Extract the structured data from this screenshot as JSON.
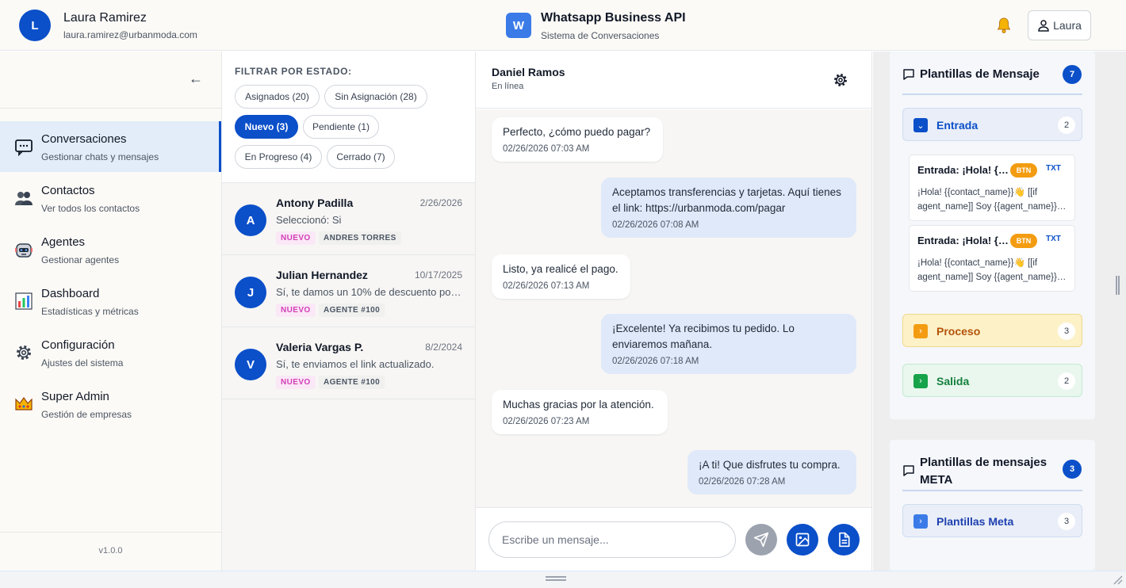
{
  "header": {
    "user_initial": "L",
    "user_name": "Laura Ramirez",
    "user_email": "laura.ramirez@urbanmoda.com",
    "app_initial": "W",
    "app_title": "Whatsapp Business API",
    "app_subtitle": "Sistema de Conversaciones",
    "user_button": "Laura",
    "icons": [
      "bell-icon",
      "user-icon"
    ]
  },
  "sidebar": {
    "collapse_icon": "←",
    "items": [
      {
        "title": "Conversaciones",
        "subtitle": "Gestionar chats y mensajes",
        "icon": "chat-icon",
        "active": true
      },
      {
        "title": "Contactos",
        "subtitle": "Ver todos los contactos",
        "icon": "contacts-icon",
        "active": false
      },
      {
        "title": "Agentes",
        "subtitle": "Gestionar agentes",
        "icon": "robot-icon",
        "active": false
      },
      {
        "title": "Dashboard",
        "subtitle": "Estadísticas y métricas",
        "icon": "bar-chart-icon",
        "active": false
      },
      {
        "title": "Configuración",
        "subtitle": "Ajustes del sistema",
        "icon": "gear-icon",
        "active": false
      },
      {
        "title": "Super Admin",
        "subtitle": "Gestión de empresas",
        "icon": "crown-icon",
        "active": false
      }
    ],
    "version": "v1.0.0"
  },
  "filters": {
    "label": "FILTRAR POR ESTADO:",
    "chips": [
      {
        "label": "Asignados (20)",
        "active": false
      },
      {
        "label": "Sin Asignación (28)",
        "active": false
      },
      {
        "label": "Nuevo (3)",
        "active": true
      },
      {
        "label": "Pendiente (1)",
        "active": false
      },
      {
        "label": "En Progreso (4)",
        "active": false
      },
      {
        "label": "Cerrado (7)",
        "active": false
      }
    ]
  },
  "conversations": [
    {
      "initial": "A",
      "name": "Antony Padilla",
      "date": "2/26/2026",
      "preview": "Seleccionó: Si",
      "status_tag": "NUEVO",
      "agent_tag": "ANDRES TORRES"
    },
    {
      "initial": "J",
      "name": "Julian Hernandez",
      "date": "10/17/2025",
      "preview": "Sí, te damos un 10% de descuento por …",
      "status_tag": "NUEVO",
      "agent_tag": "AGENTE #100"
    },
    {
      "initial": "V",
      "name": "Valeria Vargas P.",
      "date": "8/2/2024",
      "preview": "Sí, te enviamos el link actualizado.",
      "status_tag": "NUEVO",
      "agent_tag": "AGENTE #100"
    }
  ],
  "chat": {
    "contact_name": "Daniel Ramos",
    "contact_status": "En línea",
    "messages": [
      {
        "direction": "in",
        "text": "Perfecto, ¿cómo puedo pagar?",
        "time": "02/26/2026 07:03 AM"
      },
      {
        "direction": "out",
        "text": "Aceptamos transferencias y tarjetas. Aquí tienes el link: https://urbanmoda.com/pagar",
        "time": "02/26/2026 07:08 AM"
      },
      {
        "direction": "in",
        "text": "Listo, ya realicé el pago.",
        "time": "02/26/2026 07:13 AM"
      },
      {
        "direction": "out",
        "text": "¡Excelente! Ya recibimos tu pedido. Lo enviaremos mañana.",
        "time": "02/26/2026 07:18 AM"
      },
      {
        "direction": "in",
        "text": "Muchas gracias por la atención.",
        "time": "02/26/2026 07:23 AM"
      },
      {
        "direction": "out",
        "text": "¡A ti! Que disfrutes tu compra.",
        "time": "02/26/2026 07:28 AM"
      }
    ],
    "input_placeholder": "Escribe un mensaje...",
    "action_icons": [
      "send-icon",
      "image-icon",
      "document-icon"
    ]
  },
  "templates": {
    "title": "Plantillas de Mensaje",
    "count": "7",
    "sections": [
      {
        "label": "Entrada",
        "count": "2",
        "expanded": true,
        "color": "#0b4fc9"
      },
      {
        "label": "Proceso",
        "count": "3",
        "expanded": false,
        "color": "#f39c12"
      },
      {
        "label": "Salida",
        "count": "2",
        "expanded": false,
        "color": "#16a34a"
      }
    ],
    "items": [
      {
        "title": "Entrada: ¡Hola! {…",
        "btn": "BTN",
        "txt": "TXT",
        "body": "¡Hola! {{contact_name}}👋 [[if agent_name]] Soy {{agent_name}}…"
      },
      {
        "title": "Entrada: ¡Hola! {…",
        "btn": "BTN",
        "txt": "TXT",
        "body": "¡Hola! {{contact_name}}👋 [[if agent_name]] Soy {{agent_name}}…"
      }
    ]
  },
  "meta_templates": {
    "title": "Plantillas de mensajes META",
    "count": "3",
    "sections": [
      {
        "label": "Plantillas Meta",
        "count": "3",
        "color": "#3b7be8"
      }
    ]
  }
}
